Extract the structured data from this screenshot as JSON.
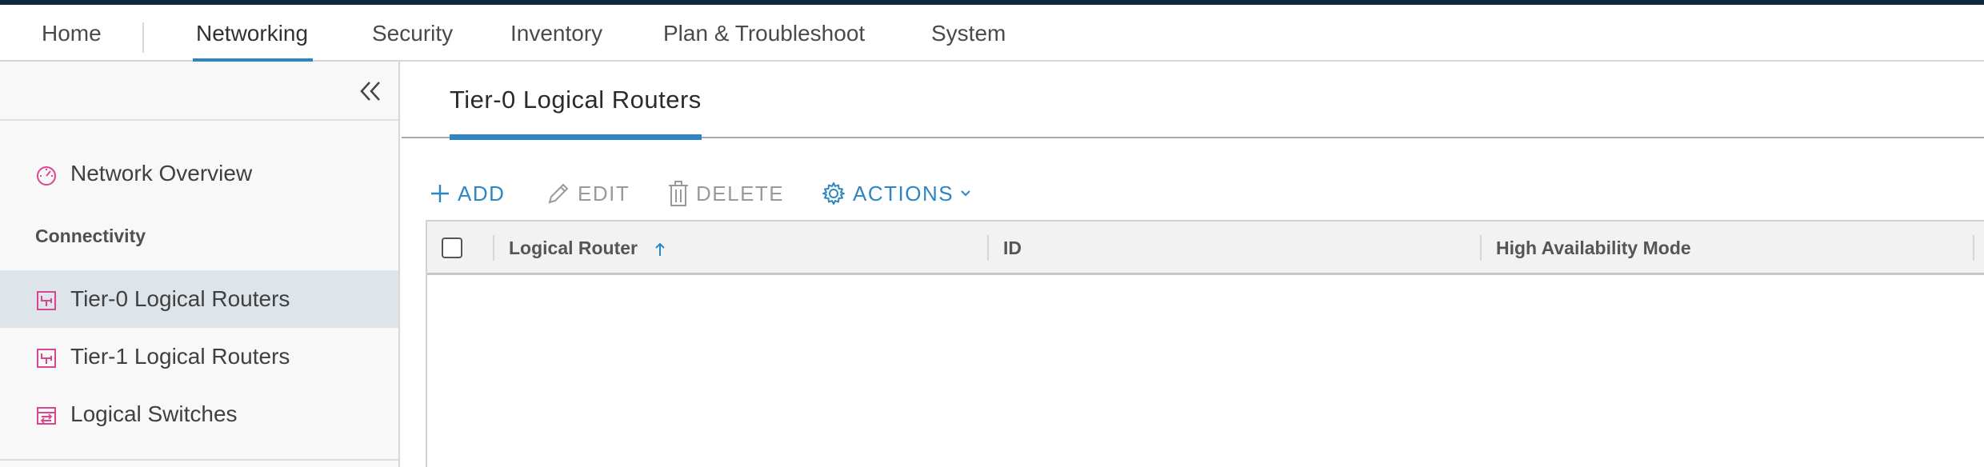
{
  "nav": {
    "items": [
      {
        "label": "Home"
      },
      {
        "label": "Networking"
      },
      {
        "label": "Security"
      },
      {
        "label": "Inventory"
      },
      {
        "label": "Plan & Troubleshoot"
      },
      {
        "label": "System"
      }
    ],
    "active": "Networking"
  },
  "sidebar": {
    "items": [
      {
        "label": "Network Overview",
        "icon": "dashboard-icon"
      },
      {
        "label": "Tier-0 Logical Routers",
        "icon": "router-icon"
      },
      {
        "label": "Tier-1 Logical Routers",
        "icon": "router-icon"
      },
      {
        "label": "Logical Switches",
        "icon": "switch-icon"
      }
    ],
    "section_header": "Connectivity",
    "active": "Tier-0 Logical Routers"
  },
  "page": {
    "tab_title": "Tier-0 Logical Routers"
  },
  "toolbar": {
    "add_label": "ADD",
    "edit_label": "EDIT",
    "delete_label": "DELETE",
    "actions_label": "ACTIONS"
  },
  "grid": {
    "columns": [
      {
        "label": "Logical Router",
        "sort": "ascending"
      },
      {
        "label": "ID"
      },
      {
        "label": "High Availability Mode"
      }
    ],
    "rows": []
  },
  "colors": {
    "accent": "#2d86c1",
    "top_bar": "#0e2a3a",
    "sidebar_icon": "#d9468f",
    "sidebar_active_bg": "#dde4ea"
  }
}
